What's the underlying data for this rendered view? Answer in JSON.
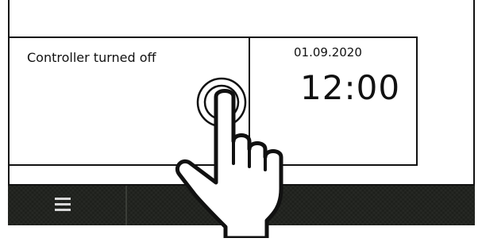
{
  "status_tile": {
    "text": "Controller turned off"
  },
  "clock_tile": {
    "date": "01.09.2020",
    "time": "12:00"
  },
  "bottom_bar": {
    "menu_icon": "hamburger-menu-icon"
  },
  "overlay": {
    "gesture_icon": "tap-hand-icon",
    "touch_indicator_icon": "touch-ring-icon"
  },
  "colors": {
    "frame": "#111111",
    "bar_background": "#1d1f1b",
    "menu_icon": "#d8d8d8",
    "background": "#ffffff"
  }
}
